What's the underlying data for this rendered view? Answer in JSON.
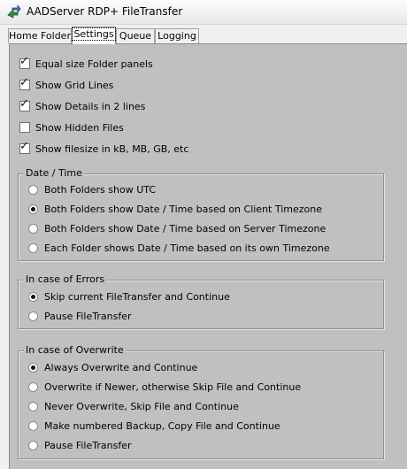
{
  "window": {
    "title": "AADServer RDP+ FileTransfer",
    "icon": "app-transfer-icon"
  },
  "tabs": [
    {
      "label": "Home Folder",
      "active": false
    },
    {
      "label": "Settings",
      "active": true
    },
    {
      "label": "Queue",
      "active": false
    },
    {
      "label": "Logging",
      "active": false
    }
  ],
  "options": [
    {
      "label": "Equal size Folder panels",
      "checked": true
    },
    {
      "label": "Show Grid Lines",
      "checked": true
    },
    {
      "label": "Show Details in 2 lines",
      "checked": true
    },
    {
      "label": "Show Hidden Files",
      "checked": false
    },
    {
      "label": "Show filesize in kB, MB, GB, etc",
      "checked": true
    }
  ],
  "date_time": {
    "title": "Date / Time",
    "choices": [
      {
        "label": "Both Folders show UTC",
        "selected": false
      },
      {
        "label": "Both Folders show Date / Time based on Client Timezone",
        "selected": true
      },
      {
        "label": "Both Folders show Date / Time based on Server Timezone",
        "selected": false
      },
      {
        "label": "Each Folder shows Date / Time based on its own Timezone",
        "selected": false
      }
    ]
  },
  "errors": {
    "title": "In case of Errors",
    "choices": [
      {
        "label": "Skip current FileTransfer and Continue",
        "selected": true
      },
      {
        "label": "Pause FileTransfer",
        "selected": false
      }
    ]
  },
  "overwrite": {
    "title": "In case of Overwrite",
    "choices": [
      {
        "label": "Always Overwrite and Continue",
        "selected": true
      },
      {
        "label": "Overwrite if Newer, otherwise Skip File and Continue",
        "selected": false
      },
      {
        "label": "Never Overwrite, Skip File and Continue",
        "selected": false
      },
      {
        "label": "Make numbered Backup, Copy File and Continue",
        "selected": false
      },
      {
        "label": "Pause FileTransfer",
        "selected": false
      }
    ]
  }
}
